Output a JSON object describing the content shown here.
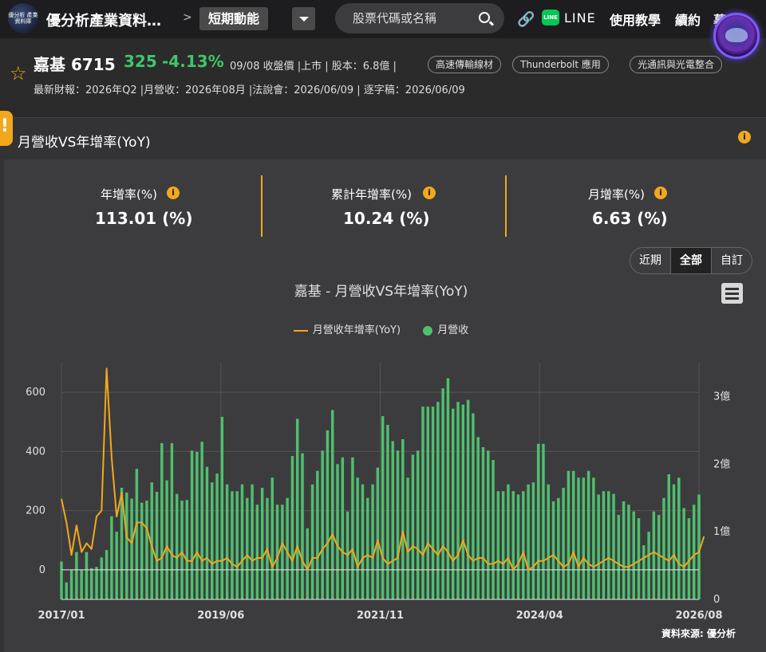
{
  "topbar": {
    "logo_text": "優分析\n產業資料庫",
    "site_title": "優分析產業資料…",
    "crumb_sep": ">",
    "crumb_current": "短期動能",
    "search_placeholder": "股票代碼或名稱",
    "line_text": "LINE",
    "nav": [
      "使用教學",
      "續約",
      "募"
    ]
  },
  "stock": {
    "name": "嘉基 6715",
    "price": "325",
    "change": "-4.13%",
    "meta": "09/08 收盤價 |上市 | 股本：6.8億 |",
    "tags": [
      "高速傳輸線材",
      "Thunderbolt 應用",
      "光通訊與光電整合"
    ],
    "sub": "最新財報：2026年Q2 |月營收：2026年08月 |法說會：2026/06/09 | 逐字稿：2026/06/09"
  },
  "panel": {
    "title": "月營收VS年增率(YoY)",
    "stats": [
      {
        "label": "年增率(%)",
        "value": "113.01 (%)"
      },
      {
        "label": "累計年增率(%)",
        "value": "10.24 (%)"
      },
      {
        "label": "月增率(%)",
        "value": "6.63 (%)"
      }
    ],
    "range_buttons": [
      "近期",
      "全部",
      "自訂"
    ],
    "active_range": "全部",
    "source": "資料來源: 優分析"
  },
  "colors": {
    "bar": "#4fbf6e",
    "line": "#f2a81d",
    "accent": "#f2a81d",
    "up_green": "#41c46b"
  },
  "chart_data": {
    "type": "bar+line",
    "title": "嘉基 - 月營收VS年增率(YoY)",
    "legend": [
      "月營收年增率(YoY)",
      "月營收"
    ],
    "x_ticks": [
      "2017/01",
      "2019/06",
      "2021/11",
      "2024/04",
      "2026/08"
    ],
    "y_left_ticks": [
      "0",
      "200",
      "400",
      "600"
    ],
    "y_left_range": [
      -100,
      700
    ],
    "y_right_ticks": [
      "0",
      "1億",
      "2億",
      "3億"
    ],
    "y_right_range": [
      0,
      3.5
    ],
    "x_start": "2017/01",
    "x_end": "2026/08",
    "series": [
      {
        "name": "月營收",
        "type": "bar",
        "unit": "億",
        "values": [
          0.56,
          0.25,
          0.43,
          0.7,
          0.44,
          0.7,
          0.46,
          0.48,
          0.62,
          0.73,
          1.23,
          1.0,
          1.65,
          1.58,
          1.49,
          1.93,
          1.43,
          1.46,
          1.73,
          1.59,
          2.31,
          1.76,
          2.31,
          1.56,
          1.46,
          1.47,
          2.2,
          2.18,
          2.33,
          1.96,
          1.73,
          1.86,
          2.7,
          1.7,
          1.6,
          1.6,
          1.7,
          1.5,
          1.7,
          1.4,
          1.65,
          1.5,
          1.8,
          1.4,
          1.4,
          1.5,
          2.12,
          2.67,
          2.16,
          1.05,
          1.7,
          1.9,
          2.2,
          2.5,
          2.8,
          2.0,
          2.1,
          1.3,
          2.1,
          1.8,
          1.7,
          1.5,
          1.7,
          1.95,
          2.71,
          2.58,
          2.34,
          2.2,
          2.37,
          1.8,
          2.14,
          2.2,
          2.85,
          2.85,
          2.85,
          2.92,
          3.12,
          3.27,
          2.82,
          2.92,
          2.88,
          2.95,
          2.75,
          2.4,
          2.25,
          2.2,
          2.06,
          1.6,
          1.6,
          1.7,
          1.6,
          1.55,
          1.6,
          1.7,
          1.73,
          2.3,
          2.3,
          1.7,
          1.45,
          1.5,
          1.65,
          1.9,
          1.9,
          1.8,
          1.8,
          1.9,
          1.8,
          1.55,
          1.6,
          1.6,
          1.56,
          1.25,
          1.45,
          1.4,
          1.3,
          1.2,
          0.8,
          1.0,
          1.3,
          1.25,
          1.5,
          1.85,
          1.7,
          1.8,
          1.35,
          1.2,
          1.4,
          1.55
        ]
      },
      {
        "name": "月營收年增率(YoY)",
        "type": "line",
        "unit": "%",
        "values": [
          240,
          160,
          50,
          150,
          60,
          90,
          70,
          180,
          200,
          680,
          380,
          180,
          260,
          110,
          90,
          160,
          160,
          140,
          80,
          30,
          40,
          80,
          50,
          40,
          60,
          30,
          30,
          60,
          30,
          40,
          20,
          30,
          30,
          40,
          20,
          10,
          30,
          50,
          30,
          40,
          40,
          70,
          10,
          40,
          90,
          60,
          30,
          80,
          30,
          0,
          40,
          40,
          70,
          90,
          120,
          80,
          60,
          50,
          70,
          10,
          40,
          50,
          40,
          100,
          40,
          20,
          30,
          40,
          130,
          60,
          80,
          70,
          50,
          90,
          70,
          50,
          80,
          60,
          30,
          50,
          100,
          50,
          30,
          40,
          40,
          20,
          20,
          30,
          20,
          40,
          0,
          20,
          60,
          0,
          10,
          30,
          30,
          40,
          50,
          30,
          10,
          20,
          60,
          10,
          40,
          20,
          10,
          20,
          30,
          40,
          30,
          20,
          10,
          10,
          20,
          30,
          40,
          50,
          60,
          50,
          40,
          30,
          50,
          20,
          10,
          30,
          50,
          60,
          113
        ]
      }
    ]
  }
}
